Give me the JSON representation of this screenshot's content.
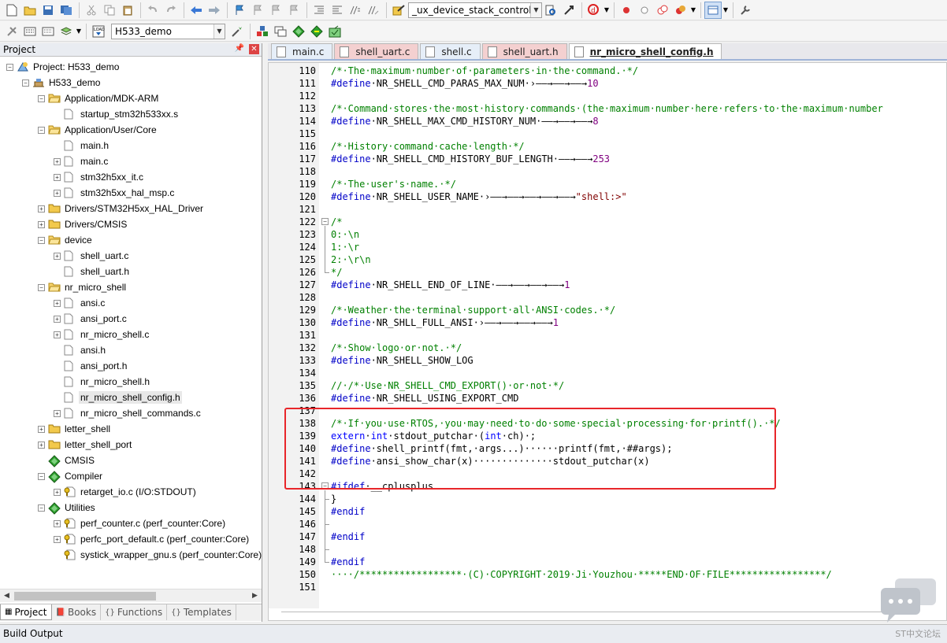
{
  "toolbar": {
    "target_combo": "_ux_device_stack_control",
    "project_combo": "H533_demo"
  },
  "project_panel": {
    "title": "Project",
    "tree": [
      {
        "label": "Project: H533_demo",
        "level": 0,
        "expander": "-",
        "icon": "project-icon"
      },
      {
        "label": "H533_demo",
        "level": 1,
        "expander": "-",
        "icon": "target-icon"
      },
      {
        "label": "Application/MDK-ARM",
        "level": 2,
        "expander": "-",
        "icon": "folder-open-icon"
      },
      {
        "label": "startup_stm32h533xx.s",
        "level": 3,
        "expander": "",
        "icon": "file-icon"
      },
      {
        "label": "Application/User/Core",
        "level": 2,
        "expander": "-",
        "icon": "folder-open-icon"
      },
      {
        "label": "main.h",
        "level": 3,
        "expander": "",
        "icon": "file-icon"
      },
      {
        "label": "main.c",
        "level": 3,
        "expander": "+",
        "icon": "file-icon"
      },
      {
        "label": "stm32h5xx_it.c",
        "level": 3,
        "expander": "+",
        "icon": "file-icon"
      },
      {
        "label": "stm32h5xx_hal_msp.c",
        "level": 3,
        "expander": "+",
        "icon": "file-icon"
      },
      {
        "label": "Drivers/STM32H5xx_HAL_Driver",
        "level": 2,
        "expander": "+",
        "icon": "folder-icon"
      },
      {
        "label": "Drivers/CMSIS",
        "level": 2,
        "expander": "+",
        "icon": "folder-icon"
      },
      {
        "label": "device",
        "level": 2,
        "expander": "-",
        "icon": "folder-open-icon"
      },
      {
        "label": "shell_uart.c",
        "level": 3,
        "expander": "+",
        "icon": "file-icon"
      },
      {
        "label": "shell_uart.h",
        "level": 3,
        "expander": "",
        "icon": "file-icon"
      },
      {
        "label": "nr_micro_shell",
        "level": 2,
        "expander": "-",
        "icon": "folder-open-icon"
      },
      {
        "label": "ansi.c",
        "level": 3,
        "expander": "+",
        "icon": "file-icon"
      },
      {
        "label": "ansi_port.c",
        "level": 3,
        "expander": "+",
        "icon": "file-icon"
      },
      {
        "label": "nr_micro_shell.c",
        "level": 3,
        "expander": "+",
        "icon": "file-icon"
      },
      {
        "label": "ansi.h",
        "level": 3,
        "expander": "",
        "icon": "file-icon"
      },
      {
        "label": "ansi_port.h",
        "level": 3,
        "expander": "",
        "icon": "file-icon"
      },
      {
        "label": "nr_micro_shell.h",
        "level": 3,
        "expander": "",
        "icon": "file-icon"
      },
      {
        "label": "nr_micro_shell_config.h",
        "level": 3,
        "expander": "",
        "icon": "file-icon",
        "selected": true
      },
      {
        "label": "nr_micro_shell_commands.c",
        "level": 3,
        "expander": "+",
        "icon": "file-icon"
      },
      {
        "label": "letter_shell",
        "level": 2,
        "expander": "+",
        "icon": "folder-icon"
      },
      {
        "label": "letter_shell_port",
        "level": 2,
        "expander": "+",
        "icon": "folder-icon"
      },
      {
        "label": "CMSIS",
        "level": 2,
        "expander": "",
        "icon": "component-icon"
      },
      {
        "label": "Compiler",
        "level": 2,
        "expander": "-",
        "icon": "component-icon"
      },
      {
        "label": "retarget_io.c (I/O:STDOUT)",
        "level": 3,
        "expander": "+",
        "icon": "key-file-icon"
      },
      {
        "label": "Utilities",
        "level": 2,
        "expander": "-",
        "icon": "component-icon"
      },
      {
        "label": "perf_counter.c (perf_counter:Core)",
        "level": 3,
        "expander": "+",
        "icon": "key-file-icon"
      },
      {
        "label": "perfc_port_default.c (perf_counter:Core)",
        "level": 3,
        "expander": "+",
        "icon": "key-file-icon"
      },
      {
        "label": "systick_wrapper_gnu.s (perf_counter:Core)",
        "level": 3,
        "expander": "",
        "icon": "key-file-icon"
      }
    ],
    "bottom_tabs": [
      "Project",
      "Books",
      "Functions",
      "Templates"
    ]
  },
  "editor_tabs": [
    {
      "label": "main.c",
      "kind": "c"
    },
    {
      "label": "shell_uart.c",
      "kind": "h"
    },
    {
      "label": "shell.c",
      "kind": "c"
    },
    {
      "label": "shell_uart.h",
      "kind": "h"
    },
    {
      "label": "nr_micro_shell_config.h",
      "kind": "h",
      "active": true
    }
  ],
  "code_lines": [
    {
      "n": "110",
      "segs": [
        [
          "cmt",
          "/*·The·maximum·number·of·parameters·in·the·command.·*/"
        ]
      ]
    },
    {
      "n": "111",
      "segs": [
        [
          "pp",
          "#define"
        ],
        [
          "",
          "·NR_SHELL_CMD_PARAS_MAX_NUM·›——→——→——→"
        ],
        [
          "num",
          "10"
        ]
      ]
    },
    {
      "n": "112",
      "segs": []
    },
    {
      "n": "113",
      "segs": [
        [
          "cmt",
          "/*·Command·stores·the·most·history·commands·(the·maximum·number·here·refers·to·the·maximum·number"
        ]
      ]
    },
    {
      "n": "114",
      "segs": [
        [
          "pp",
          "#define"
        ],
        [
          "",
          "·NR_SHELL_MAX_CMD_HISTORY_NUM·——→——→——→"
        ],
        [
          "num",
          "8"
        ]
      ]
    },
    {
      "n": "115",
      "segs": []
    },
    {
      "n": "116",
      "segs": [
        [
          "cmt",
          "/*·History·command·cache·length·*/"
        ]
      ]
    },
    {
      "n": "117",
      "segs": [
        [
          "pp",
          "#define"
        ],
        [
          "",
          "·NR_SHELL_CMD_HISTORY_BUF_LENGTH·——→——→"
        ],
        [
          "num",
          "253"
        ]
      ]
    },
    {
      "n": "118",
      "segs": []
    },
    {
      "n": "119",
      "segs": [
        [
          "cmt",
          "/*·The·user's·name.·*/"
        ]
      ]
    },
    {
      "n": "120",
      "segs": [
        [
          "pp",
          "#define"
        ],
        [
          "",
          "·NR_SHELL_USER_NAME·›——→——→——→——→——→"
        ],
        [
          "str",
          "\"shell:>\""
        ]
      ]
    },
    {
      "n": "121",
      "segs": []
    },
    {
      "n": "122",
      "segs": [
        [
          "cmt",
          "/*"
        ]
      ],
      "fold": "-"
    },
    {
      "n": "123",
      "segs": [
        [
          "cmt",
          "0:·\\n"
        ]
      ]
    },
    {
      "n": "124",
      "segs": [
        [
          "cmt",
          "1:·\\r"
        ]
      ]
    },
    {
      "n": "125",
      "segs": [
        [
          "cmt",
          "2:·\\r\\n"
        ]
      ]
    },
    {
      "n": "126",
      "segs": [
        [
          "cmt",
          "*/"
        ]
      ]
    },
    {
      "n": "127",
      "segs": [
        [
          "pp",
          "#define"
        ],
        [
          "",
          "·NR_SHELL_END_OF_LINE·——→——→——→——→"
        ],
        [
          "num",
          "1"
        ]
      ]
    },
    {
      "n": "128",
      "segs": []
    },
    {
      "n": "129",
      "segs": [
        [
          "cmt",
          "/*·Weather·the·terminal·support·all·ANSI·codes.·*/"
        ]
      ]
    },
    {
      "n": "130",
      "segs": [
        [
          "pp",
          "#define"
        ],
        [
          "",
          "·NR_SHLL_FULL_ANSI·›——→——→——→——→"
        ],
        [
          "num",
          "1"
        ]
      ]
    },
    {
      "n": "131",
      "segs": []
    },
    {
      "n": "132",
      "segs": [
        [
          "cmt",
          "/*·Show·logo·or·not.·*/"
        ]
      ]
    },
    {
      "n": "133",
      "segs": [
        [
          "pp",
          "#define"
        ],
        [
          "",
          "·NR_SHELL_SHOW_LOG"
        ]
      ]
    },
    {
      "n": "134",
      "segs": []
    },
    {
      "n": "135",
      "segs": [
        [
          "cmt",
          "//·/*·Use·NR_SHELL_CMD_EXPORT()·or·not·*/"
        ]
      ]
    },
    {
      "n": "136",
      "segs": [
        [
          "pp",
          "#define"
        ],
        [
          "",
          "·NR_SHELL_USING_EXPORT_CMD"
        ]
      ]
    },
    {
      "n": "137",
      "segs": []
    },
    {
      "n": "138",
      "segs": [
        [
          "cmt",
          "/*·If·you·use·RTOS,·you·may·need·to·do·some·special·processing·for·printf().·*/"
        ]
      ]
    },
    {
      "n": "139",
      "segs": [
        [
          "kw",
          "extern"
        ],
        [
          "",
          "·"
        ],
        [
          "kw",
          "int"
        ],
        [
          "",
          "·stdout_putchar·("
        ],
        [
          "kw",
          "int"
        ],
        [
          "",
          "·ch)·;"
        ]
      ]
    },
    {
      "n": "140",
      "segs": [
        [
          "pp",
          "#define"
        ],
        [
          "",
          "·shell_printf(fmt,·args...)······printf(fmt,·##args);"
        ]
      ]
    },
    {
      "n": "141",
      "segs": [
        [
          "pp",
          "#define"
        ],
        [
          "",
          "·ansi_show_char(x)··············stdout_putchar(x)"
        ]
      ]
    },
    {
      "n": "142",
      "segs": []
    },
    {
      "n": "143",
      "segs": [
        [
          "pp",
          "#ifdef"
        ],
        [
          "",
          "·__cplusplus"
        ]
      ],
      "fold": "-"
    },
    {
      "n": "144",
      "segs": [
        [
          "",
          "}"
        ]
      ]
    },
    {
      "n": "145",
      "segs": [
        [
          "pp",
          "#endif"
        ]
      ]
    },
    {
      "n": "146",
      "segs": []
    },
    {
      "n": "147",
      "segs": [
        [
          "pp",
          "#endif"
        ]
      ]
    },
    {
      "n": "148",
      "segs": []
    },
    {
      "n": "149",
      "segs": [
        [
          "pp",
          "#endif"
        ]
      ]
    },
    {
      "n": "150",
      "segs": [
        [
          "cmt",
          "····/******************·(C)·COPYRIGHT·2019·Ji·Youzhou·*****END·OF·FILE*****************/"
        ]
      ]
    },
    {
      "n": "151",
      "segs": []
    }
  ],
  "build_output": {
    "title": "Build Output"
  },
  "watermark": {
    "text": "ST中文论坛"
  }
}
